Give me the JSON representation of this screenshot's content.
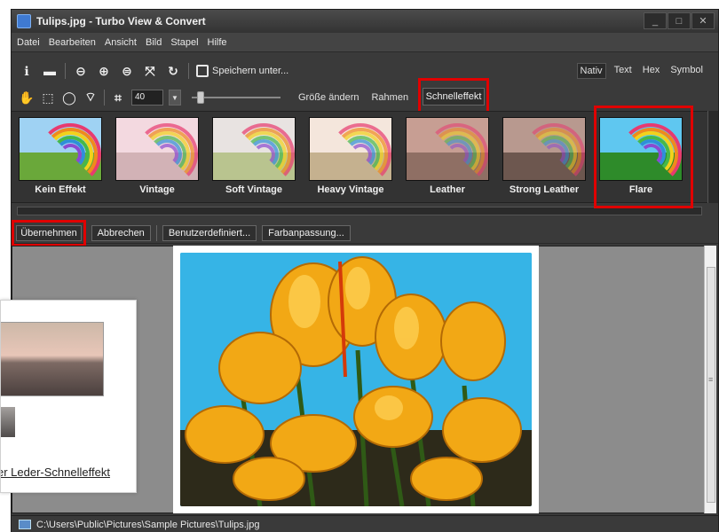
{
  "window": {
    "title": "Tulips.jpg - Turbo View & Convert",
    "controls": [
      "_",
      "□",
      "✕"
    ]
  },
  "menu": [
    "Datei",
    "Bearbeiten",
    "Ansicht",
    "Bild",
    "Stapel",
    "Hilfe"
  ],
  "toolbar1": {
    "save_label": "Speichern unter...",
    "view_modes": [
      "Nativ",
      "Text",
      "Hex",
      "Symbol"
    ],
    "active_view_mode": "Nativ",
    "icons": [
      "info-icon",
      "folder-icon",
      "zoom-out-icon",
      "zoom-in-icon",
      "zoom-reset-icon",
      "fit-icon",
      "rotate-icon"
    ]
  },
  "toolbar2": {
    "size_value": "40",
    "resize_label": "Größe ändern",
    "frame_label": "Rahmen",
    "quick_effect_label": "Schnelleffekt"
  },
  "effects": [
    {
      "name": "Kein Effekt",
      "sky": "#9fd2f3",
      "grass": "#6aa83a"
    },
    {
      "name": "Vintage",
      "sky": "#f3d9e0",
      "grass": "#d2b2b6"
    },
    {
      "name": "Soft Vintage",
      "sky": "#e8e3e1",
      "grass": "#b9c48f"
    },
    {
      "name": "Heavy Vintage",
      "sky": "#f4e6dc",
      "grass": "#c5b18f"
    },
    {
      "name": "Leather",
      "sky": "#c79e93",
      "grass": "#8f6f64"
    },
    {
      "name": "Strong Leather",
      "sky": "#b8998f",
      "grass": "#6d574f"
    },
    {
      "name": "Flare",
      "sky": "#5fc7f0",
      "grass": "#2e8b2a"
    }
  ],
  "selected_effect": "Flare",
  "actions": {
    "accept": "Übernehmen",
    "cancel": "Abbrechen",
    "custom": "Benutzerdefiniert...",
    "color": "Farbanpassung..."
  },
  "status": {
    "path": "C:\\Users\\Public\\Pictures\\Sample Pictures\\Tulips.jpg"
  },
  "tip": {
    "caption": "er Leder-Schnelleffekt"
  },
  "colors": {
    "highlight": "#e00000",
    "window_bg": "#3a3a3a",
    "canvas_bg": "#8c8c8c"
  }
}
